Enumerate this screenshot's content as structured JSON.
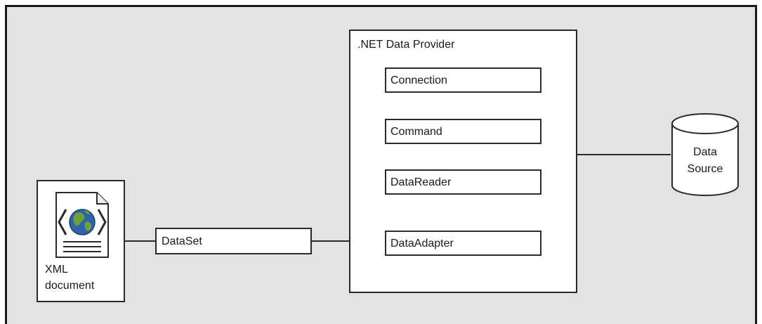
{
  "provider": {
    "title": ".NET Data Provider",
    "components": [
      "Connection",
      "Command",
      "DataReader",
      "DataAdapter"
    ]
  },
  "dataset": {
    "label": "DataSet"
  },
  "xml": {
    "line1": "XML",
    "line2": "document"
  },
  "datasource": {
    "line1": "Data",
    "line2": "Source"
  }
}
